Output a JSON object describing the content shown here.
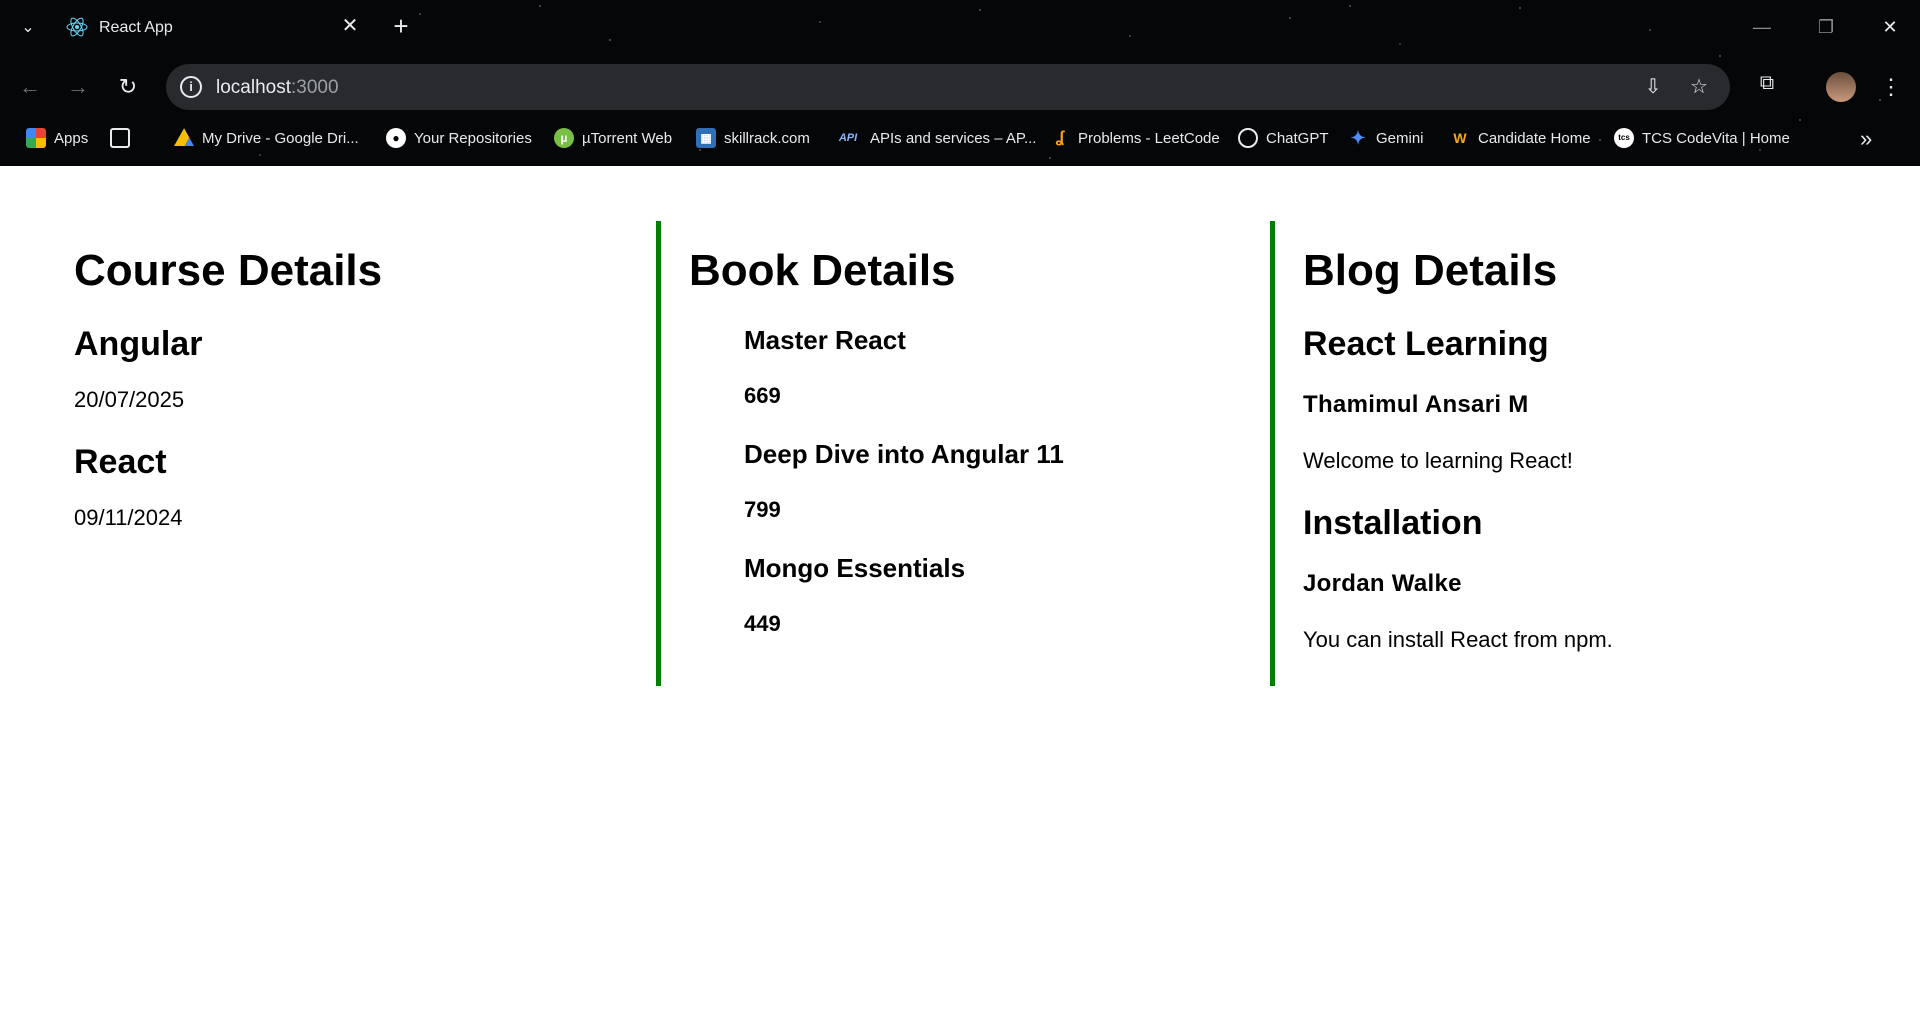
{
  "browser": {
    "tab": {
      "title": "React App"
    },
    "address": {
      "host": "localhost",
      "port": ":3000"
    },
    "bookmarks": [
      {
        "label": "Apps",
        "icon": "apps-grid-icon"
      },
      {
        "label": "",
        "icon": "tab-groups-icon"
      },
      {
        "label": "My Drive - Google Dri...",
        "icon": "google-drive-icon"
      },
      {
        "label": "Your Repositories",
        "icon": "github-icon"
      },
      {
        "label": "µTorrent Web",
        "icon": "utorrent-icon"
      },
      {
        "label": "skillrack.com",
        "icon": "skillrack-icon"
      },
      {
        "label": "APIs and services – AP...",
        "icon": "api-icon"
      },
      {
        "label": "Problems - LeetCode",
        "icon": "leetcode-icon"
      },
      {
        "label": "ChatGPT",
        "icon": "chatgpt-icon"
      },
      {
        "label": "Gemini",
        "icon": "gemini-icon"
      },
      {
        "label": "Candidate Home",
        "icon": "candidate-home-icon"
      },
      {
        "label": "TCS CodeVita | Home",
        "icon": "tcs-icon"
      }
    ]
  },
  "course": {
    "heading": "Course Details",
    "items": [
      {
        "name": "Angular",
        "date": "20/07/2025"
      },
      {
        "name": "React",
        "date": "09/11/2024"
      }
    ]
  },
  "book": {
    "heading": "Book Details",
    "items": [
      {
        "name": "Master React",
        "price": "669"
      },
      {
        "name": "Deep Dive into Angular 11",
        "price": "799"
      },
      {
        "name": "Mongo Essentials",
        "price": "449"
      }
    ]
  },
  "blog": {
    "heading": "Blog Details",
    "items": [
      {
        "title": "React Learning",
        "author": "Thamimul Ansari M",
        "content": "Welcome to learning React!"
      },
      {
        "title": "Installation",
        "author": "Jordan Walke",
        "content": "You can install React from npm."
      }
    ]
  },
  "colors": {
    "panel_border": "#008000",
    "chrome_bg": "#050608",
    "omnibox_bg": "#282a2d"
  }
}
